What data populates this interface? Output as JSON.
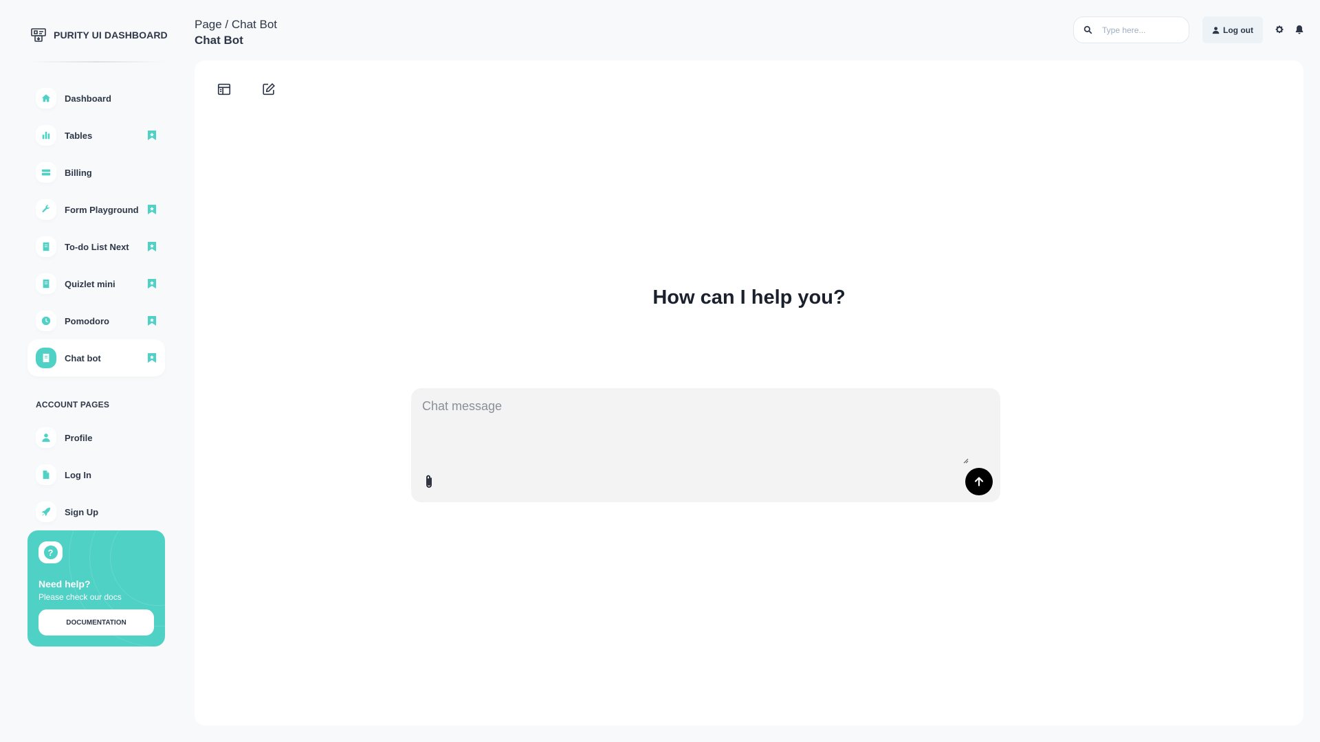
{
  "brand": {
    "name": "PURITY UI DASHBOARD",
    "logo_icon": "dashboard-logo-icon"
  },
  "sidebar": {
    "items": [
      {
        "label": "Dashboard",
        "icon": "home-icon",
        "bookmark": false,
        "active": false
      },
      {
        "label": "Tables",
        "icon": "bar-chart-icon",
        "bookmark": true,
        "active": false
      },
      {
        "label": "Billing",
        "icon": "credit-card-icon",
        "bookmark": false,
        "active": false
      },
      {
        "label": "Form Playground",
        "icon": "wrench-icon",
        "bookmark": true,
        "active": false
      },
      {
        "label": "To-do List Next",
        "icon": "document-icon",
        "bookmark": true,
        "active": false
      },
      {
        "label": "Quizlet mini",
        "icon": "document-icon",
        "bookmark": true,
        "active": false
      },
      {
        "label": "Pomodoro",
        "icon": "clock-icon",
        "bookmark": true,
        "active": false
      },
      {
        "label": "Chat bot",
        "icon": "document-icon",
        "bookmark": true,
        "active": true
      }
    ],
    "account_title": "ACCOUNT PAGES",
    "account_items": [
      {
        "label": "Profile",
        "icon": "person-icon"
      },
      {
        "label": "Log In",
        "icon": "file-icon"
      },
      {
        "label": "Sign Up",
        "icon": "rocket-icon"
      }
    ],
    "help": {
      "title": "Need help?",
      "subtitle": "Please check our docs",
      "button_label": "DOCUMENTATION",
      "icon": "question-icon"
    }
  },
  "header": {
    "breadcrumb": "Page / Chat Bot",
    "title": "Chat Bot",
    "search_placeholder": "Type here...",
    "logout_label": "Log out"
  },
  "main": {
    "greeting": "How can I help you?",
    "chat_placeholder": "Chat message"
  },
  "colors": {
    "accent": "#4fd1c5",
    "background": "#f8f9fa",
    "text": "#2d3748",
    "send_button": "#000000"
  }
}
